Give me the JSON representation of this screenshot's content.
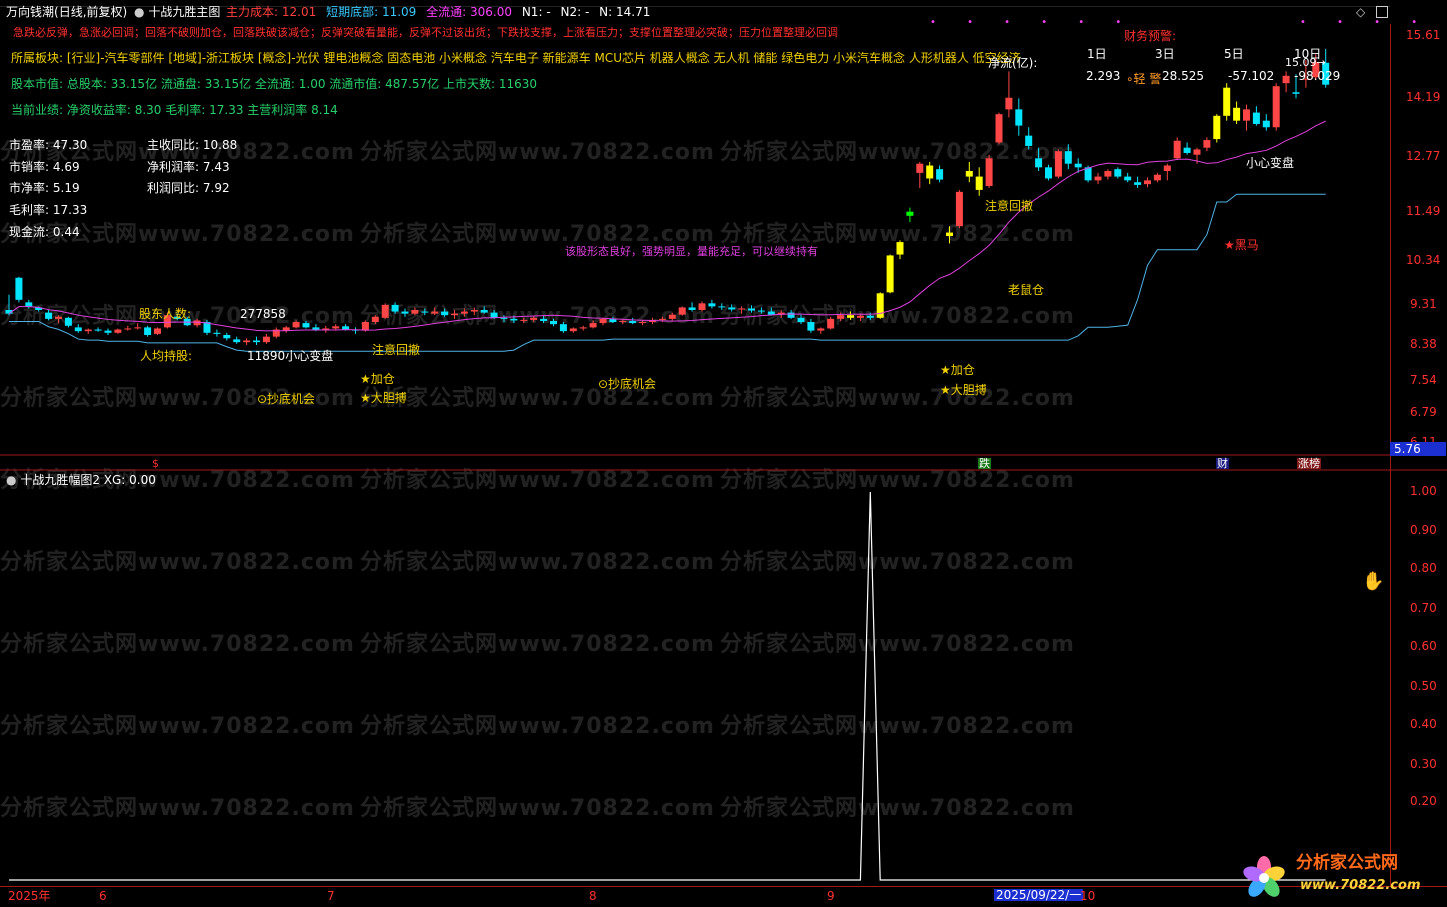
{
  "header": {
    "stock_name": "万向钱潮",
    "period": "(日线,前复权)",
    "indicator_name": "十战九胜主图",
    "cost_label": "主力成本:",
    "cost_value": "12.01",
    "short_bottom_label": "短期底部:",
    "short_bottom_value": "11.09",
    "full_float_label": "全流通:",
    "full_float_value": "306.00",
    "n1_label": "N1:",
    "n1_value": "-",
    "n2_label": "N2:",
    "n2_value": "-",
    "n_label": "N:",
    "n_value": "14.71"
  },
  "warning_line": "急跌必反弹，急涨必回调；回落不破则加仓，回落跌破该减仓；反弹突破看量能，反弹不过该出货；下跌找支撑，上涨看压力；支撑位置整理必突破；压力位置整理必回调",
  "sector_line": "所属板块: [行业]-汽车零部件 [地域]-浙江板块 [概念]-光伏 锂电池概念 固态电池 小米概念 汽车电子 新能源车 MCU芯片 机器人概念 无人机 储能 绿色电力 小米汽车概念 人形机器人 低空经济",
  "capital_line": "股本市值: 总股本: 33.15亿 流通盘: 33.15亿 全流通: 1.00 流通市值: 487.57亿 上市天数: 11630",
  "perf_line": "当前业绩:  净资收益率: 8.30 毛利率: 17.33 主营利润率 8.14",
  "ratios_left": [
    {
      "label": "市盈率:",
      "value": "47.30"
    },
    {
      "label": "市销率:",
      "value": "4.69"
    },
    {
      "label": "市净率:",
      "value": "5.19"
    },
    {
      "label": "毛利率:",
      "value": "17.33"
    },
    {
      "label": "现金流:",
      "value": "0.44"
    }
  ],
  "ratios_right": [
    {
      "label": "主收同比:",
      "value": "10.88"
    },
    {
      "label": "净利润率:",
      "value": "7.43"
    },
    {
      "label": "利润同比:",
      "value": "7.92"
    }
  ],
  "finance_warning": "财务预警:",
  "net_flow": {
    "label": "净流(亿):",
    "headers": [
      "1日",
      "3日",
      "5日",
      "10日"
    ],
    "values": [
      "2.293",
      "28.525",
      "-57.102",
      "-98.029"
    ],
    "badge": "轻 警"
  },
  "comment": "该股形态良好，强势明显，量能充足，可以继续持有",
  "shareholders": {
    "label": "股东人数:",
    "value": "277858"
  },
  "per_capita": {
    "label": "人均持股:",
    "value": "11890"
  },
  "signals": {
    "caution_change": "小心变盘",
    "attention_pullback": "注意回撤",
    "add_position": "★加仓",
    "bold_fight": "★大胆搏",
    "bottom_fishing": "⊙抄底机会",
    "old_rat": "老鼠仓",
    "dark_horse": "★黑马",
    "high_note": "15.09"
  },
  "price_axis": [
    "15.61",
    "14.19",
    "12.77",
    "11.49",
    "10.34",
    "9.31",
    "8.38",
    "7.54",
    "6.79",
    "6.11"
  ],
  "price_current": "5.76",
  "bottom_markers": [
    "$",
    "跌",
    "财",
    "涨榜"
  ],
  "sub_panel": {
    "title": "十战九胜幅图2",
    "xg_label": "XG:",
    "xg_value": "0.00",
    "axis": [
      "1.00",
      "0.90",
      "0.80",
      "0.70",
      "0.60",
      "0.50",
      "0.40",
      "0.30",
      "0.20"
    ]
  },
  "time_axis": [
    "2025年",
    "6",
    "7",
    "8",
    "9",
    "2025/09/22/一",
    "10"
  ],
  "watermark": "分析家公式网www.70822.com",
  "logo": {
    "name": "分析家公式网",
    "url": "www.70822.com"
  },
  "colors": {
    "up": "#ff4646",
    "down": "#00e5ff",
    "signal_yellow": "#ffff00",
    "signal_green": "#00ff00",
    "ma": "#e040e0",
    "support": "#4fb3e8",
    "gold": "#f0d000",
    "magenta_text": "#ff40ff"
  },
  "chart_data": {
    "type": "candlestick",
    "x": [
      "2025-05-21",
      "2025-05-22",
      "2025-05-23",
      "2025-05-26",
      "2025-05-27",
      "2025-05-28",
      "2025-05-29",
      "2025-05-30",
      "2025-06-03",
      "2025-06-04",
      "2025-06-05",
      "2025-06-06",
      "2025-06-09",
      "2025-06-10",
      "2025-06-11",
      "2025-06-12",
      "2025-06-13",
      "2025-06-16",
      "2025-06-17",
      "2025-06-18",
      "2025-06-19",
      "2025-06-20",
      "2025-06-23",
      "2025-06-24",
      "2025-06-25",
      "2025-06-26",
      "2025-06-27",
      "2025-06-30",
      "2025-07-01",
      "2025-07-02",
      "2025-07-03",
      "2025-07-04",
      "2025-07-07",
      "2025-07-08",
      "2025-07-09",
      "2025-07-10",
      "2025-07-11",
      "2025-07-14",
      "2025-07-15",
      "2025-07-16",
      "2025-07-17",
      "2025-07-18",
      "2025-07-21",
      "2025-07-22",
      "2025-07-23",
      "2025-07-24",
      "2025-07-25",
      "2025-07-28",
      "2025-07-29",
      "2025-07-30",
      "2025-07-31",
      "2025-08-01",
      "2025-08-04",
      "2025-08-05",
      "2025-08-06",
      "2025-08-07",
      "2025-08-08",
      "2025-08-11",
      "2025-08-12",
      "2025-08-13",
      "2025-08-14",
      "2025-08-15",
      "2025-08-18",
      "2025-08-19",
      "2025-08-20",
      "2025-08-21",
      "2025-08-22",
      "2025-08-25",
      "2025-08-26",
      "2025-08-27",
      "2025-08-28",
      "2025-08-29",
      "2025-09-01",
      "2025-09-02",
      "2025-09-03",
      "2025-09-04",
      "2025-09-05",
      "2025-09-08",
      "2025-09-09",
      "2025-09-10",
      "2025-09-11",
      "2025-09-12",
      "2025-09-15",
      "2025-09-16",
      "2025-09-17",
      "2025-09-18",
      "2025-09-19",
      "2025-09-22",
      "2025-09-23",
      "2025-09-24",
      "2025-09-25",
      "2025-09-26",
      "2025-09-29",
      "2025-09-30",
      "2025-10-09",
      "2025-10-10",
      "2025-10-13",
      "2025-10-14",
      "2025-10-15",
      "2025-10-16",
      "2025-10-17",
      "2025-10-20",
      "2025-10-21",
      "2025-10-22",
      "2025-10-23",
      "2025-10-24",
      "2025-10-27",
      "2025-10-28",
      "2025-10-29",
      "2025-10-30",
      "2025-10-31",
      "2025-11-03",
      "2025-11-04",
      "2025-11-05",
      "2025-11-06",
      "2025-11-07",
      "2025-11-10",
      "2025-11-11",
      "2025-11-12",
      "2025-11-13",
      "2025-11-14",
      "2025-11-17",
      "2025-11-18",
      "2025-11-19",
      "2025-11-20",
      "2025-11-21",
      "2025-11-24",
      "2025-11-25",
      "2025-11-26",
      "2025-11-27",
      "2025-11-28",
      "2025-12-01",
      "2025-12-02",
      "2025-12-03",
      "2025-12-04",
      "2025-12-05"
    ],
    "ohlc": [
      [
        8.05,
        8.35,
        7.95,
        7.98
      ],
      [
        8.7,
        8.72,
        8.2,
        8.25
      ],
      [
        8.2,
        8.25,
        8.08,
        8.12
      ],
      [
        8.1,
        8.12,
        8.02,
        8.05
      ],
      [
        8.0,
        8.05,
        7.85,
        7.88
      ],
      [
        7.88,
        7.95,
        7.8,
        7.92
      ],
      [
        7.9,
        7.92,
        7.72,
        7.75
      ],
      [
        7.72,
        7.78,
        7.62,
        7.65
      ],
      [
        7.65,
        7.7,
        7.6,
        7.68
      ],
      [
        7.68,
        7.72,
        7.64,
        7.66
      ],
      [
        7.66,
        7.7,
        7.58,
        7.62
      ],
      [
        7.62,
        7.7,
        7.6,
        7.68
      ],
      [
        7.7,
        7.75,
        7.66,
        7.7
      ],
      [
        7.72,
        7.8,
        7.68,
        7.72
      ],
      [
        7.72,
        7.75,
        7.55,
        7.58
      ],
      [
        7.6,
        7.72,
        7.58,
        7.7
      ],
      [
        7.72,
        8.0,
        7.7,
        7.95
      ],
      [
        7.92,
        7.98,
        7.85,
        7.88
      ],
      [
        7.88,
        7.92,
        7.74,
        7.76
      ],
      [
        7.76,
        7.88,
        7.72,
        7.85
      ],
      [
        7.82,
        7.86,
        7.58,
        7.62
      ],
      [
        7.62,
        7.68,
        7.55,
        7.6
      ],
      [
        7.58,
        7.62,
        7.48,
        7.52
      ],
      [
        7.5,
        7.55,
        7.42,
        7.45
      ],
      [
        7.45,
        7.52,
        7.4,
        7.48
      ],
      [
        7.48,
        7.55,
        7.4,
        7.45
      ],
      [
        7.45,
        7.6,
        7.42,
        7.55
      ],
      [
        7.55,
        7.72,
        7.52,
        7.68
      ],
      [
        7.66,
        7.75,
        7.62,
        7.72
      ],
      [
        7.72,
        7.85,
        7.7,
        7.82
      ],
      [
        7.8,
        7.84,
        7.7,
        7.72
      ],
      [
        7.72,
        7.78,
        7.65,
        7.68
      ],
      [
        7.68,
        7.75,
        7.62,
        7.7
      ],
      [
        7.7,
        7.78,
        7.66,
        7.74
      ],
      [
        7.74,
        7.78,
        7.66,
        7.68
      ],
      [
        7.68,
        7.72,
        7.6,
        7.66
      ],
      [
        7.66,
        7.85,
        7.64,
        7.82
      ],
      [
        7.82,
        7.95,
        7.78,
        7.92
      ],
      [
        7.9,
        8.18,
        7.88,
        8.15
      ],
      [
        8.15,
        8.2,
        7.98,
        8.02
      ],
      [
        8.02,
        8.08,
        7.92,
        7.98
      ],
      [
        7.98,
        8.1,
        7.95,
        8.05
      ],
      [
        8.02,
        8.08,
        7.95,
        8.0
      ],
      [
        7.98,
        8.1,
        7.95,
        8.02
      ],
      [
        8.02,
        8.08,
        7.92,
        7.95
      ],
      [
        7.95,
        8.05,
        7.88,
        7.98
      ],
      [
        7.98,
        8.08,
        7.92,
        8.02
      ],
      [
        8.02,
        8.1,
        7.95,
        8.05
      ],
      [
        8.05,
        8.12,
        7.98,
        8.0
      ],
      [
        8.0,
        8.05,
        7.88,
        7.9
      ],
      [
        7.9,
        7.95,
        7.82,
        7.88
      ],
      [
        7.88,
        7.94,
        7.8,
        7.85
      ],
      [
        7.85,
        7.9,
        7.8,
        7.86
      ],
      [
        7.86,
        7.94,
        7.82,
        7.9
      ],
      [
        7.88,
        7.94,
        7.8,
        7.84
      ],
      [
        7.84,
        7.88,
        7.74,
        7.78
      ],
      [
        7.78,
        7.82,
        7.62,
        7.65
      ],
      [
        7.65,
        7.72,
        7.62,
        7.7
      ],
      [
        7.7,
        7.75,
        7.66,
        7.72
      ],
      [
        7.72,
        7.85,
        7.7,
        7.8
      ],
      [
        7.8,
        7.9,
        7.76,
        7.88
      ],
      [
        7.88,
        7.92,
        7.8,
        7.82
      ],
      [
        7.82,
        7.88,
        7.78,
        7.84
      ],
      [
        7.84,
        7.9,
        7.78,
        7.8
      ],
      [
        7.8,
        7.86,
        7.76,
        7.82
      ],
      [
        7.82,
        7.9,
        7.78,
        7.86
      ],
      [
        7.86,
        7.92,
        7.82,
        7.88
      ],
      [
        7.88,
        8.0,
        7.85,
        7.96
      ],
      [
        7.96,
        8.12,
        7.94,
        8.1
      ],
      [
        8.1,
        8.2,
        8.02,
        8.05
      ],
      [
        8.05,
        8.22,
        8.02,
        8.18
      ],
      [
        8.18,
        8.25,
        8.08,
        8.12
      ],
      [
        8.12,
        8.18,
        8.05,
        8.1
      ],
      [
        8.1,
        8.16,
        8.02,
        8.06
      ],
      [
        8.06,
        8.12,
        7.98,
        8.08
      ],
      [
        8.08,
        8.14,
        8.0,
        8.04
      ],
      [
        8.04,
        8.1,
        7.98,
        8.02
      ],
      [
        8.02,
        8.1,
        7.94,
        7.96
      ],
      [
        7.96,
        8.04,
        7.9,
        8.0
      ],
      [
        8.0,
        8.05,
        7.88,
        7.9
      ],
      [
        7.9,
        7.96,
        7.78,
        7.82
      ],
      [
        7.82,
        7.88,
        7.62,
        7.66
      ],
      [
        7.66,
        7.72,
        7.6,
        7.7
      ],
      [
        7.7,
        7.92,
        7.68,
        7.88
      ],
      [
        7.88,
        8.0,
        7.84,
        7.95
      ],
      [
        7.95,
        8.02,
        7.86,
        7.9
      ],
      [
        7.9,
        7.98,
        7.84,
        7.94
      ],
      [
        7.94,
        8.0,
        7.86,
        7.9
      ],
      [
        7.9,
        8.4,
        7.88,
        8.38
      ],
      [
        8.4,
        9.2,
        8.38,
        9.18
      ],
      [
        9.2,
        9.52,
        9.1,
        9.48
      ],
      [
        10.1,
        10.3,
        9.95,
        10.2
      ],
      [
        11.2,
        11.5,
        10.8,
        11.45
      ],
      [
        11.05,
        11.5,
        10.9,
        11.4
      ],
      [
        11.3,
        11.4,
        10.95,
        11.02
      ],
      [
        9.7,
        9.85,
        9.45,
        9.62
      ],
      [
        9.85,
        10.75,
        9.8,
        10.7
      ],
      [
        11.1,
        11.5,
        10.95,
        11.25
      ],
      [
        10.75,
        11.35,
        10.6,
        11.1
      ],
      [
        10.85,
        11.7,
        10.8,
        11.6
      ],
      [
        12.05,
        12.95,
        12.0,
        12.9
      ],
      [
        13.05,
        14.3,
        12.8,
        13.42
      ],
      [
        13.05,
        13.4,
        12.25,
        12.55
      ],
      [
        12.25,
        12.5,
        11.85,
        11.95
      ],
      [
        11.6,
        11.9,
        11.25,
        11.35
      ],
      [
        11.35,
        11.42,
        11.0,
        11.05
      ],
      [
        11.1,
        11.85,
        11.05,
        11.8
      ],
      [
        11.8,
        12.0,
        11.3,
        11.45
      ],
      [
        11.45,
        11.6,
        11.2,
        11.35
      ],
      [
        11.35,
        11.4,
        10.95,
        11.0
      ],
      [
        11.0,
        11.2,
        10.9,
        11.1
      ],
      [
        11.1,
        11.3,
        11.02,
        11.25
      ],
      [
        11.3,
        11.35,
        11.05,
        11.1
      ],
      [
        11.1,
        11.2,
        10.95,
        11.0
      ],
      [
        10.95,
        11.1,
        10.8,
        10.88
      ],
      [
        10.9,
        11.08,
        10.82,
        11.0
      ],
      [
        11.0,
        11.2,
        10.95,
        11.15
      ],
      [
        11.25,
        11.45,
        11.0,
        11.4
      ],
      [
        11.6,
        12.2,
        11.55,
        12.1
      ],
      [
        11.9,
        12.05,
        11.7,
        11.75
      ],
      [
        11.7,
        11.9,
        11.45,
        11.85
      ],
      [
        11.9,
        12.2,
        11.8,
        12.12
      ],
      [
        12.15,
        12.9,
        12.05,
        12.85
      ],
      [
        12.85,
        13.9,
        12.7,
        13.75
      ],
      [
        13.1,
        13.3,
        12.6,
        12.7
      ],
      [
        12.7,
        13.2,
        12.4,
        13.05
      ],
      [
        12.95,
        13.15,
        12.55,
        12.6
      ],
      [
        12.7,
        12.9,
        12.4,
        12.5
      ],
      [
        12.5,
        13.9,
        12.4,
        13.8
      ],
      [
        13.9,
        14.3,
        13.6,
        14.15
      ],
      [
        13.6,
        14.2,
        13.4,
        13.55
      ],
      [
        14.05,
        14.7,
        13.75,
        14.05
      ],
      [
        14.1,
        14.9,
        14.0,
        14.62
      ],
      [
        14.6,
        15.1,
        13.75,
        13.85
      ]
    ],
    "signal_candles": {
      "yellow": [
        85,
        88,
        89,
        90,
        93,
        95,
        97,
        98,
        122,
        123,
        124
      ],
      "green": [
        91
      ]
    },
    "overlays": [
      "ma",
      "support"
    ],
    "annotations": [
      {
        "text": "人均持股:",
        "date": "2025-06-09"
      },
      {
        "text": "⊙抄底机会",
        "date": "2025-06-27"
      },
      {
        "text": "★加仓",
        "date": "2025-07-14"
      },
      {
        "text": "★大胆搏",
        "date": "2025-07-14"
      },
      {
        "text": "注意回撤",
        "date": "2025-07-14"
      },
      {
        "text": "⊙抄底机会",
        "date": "2025-08-14"
      },
      {
        "text": "★加仓",
        "date": "2025-09-22"
      },
      {
        "text": "★大胆搏",
        "date": "2025-09-22"
      },
      {
        "text": "注意回撤",
        "date": "2025-09-30"
      },
      {
        "text": "老鼠仓",
        "date": "2025-10-09"
      },
      {
        "text": "★黑马",
        "date": "2025-11-06"
      },
      {
        "text": "小心变盘",
        "date": "2025-11-24"
      }
    ],
    "sub_series": {
      "name": "XG",
      "spike_date": "2025-09-22",
      "spike_value": 1.0,
      "baseline": 0.0
    },
    "y_scale": "log",
    "ylim": [
      5.76,
      15.61
    ]
  }
}
